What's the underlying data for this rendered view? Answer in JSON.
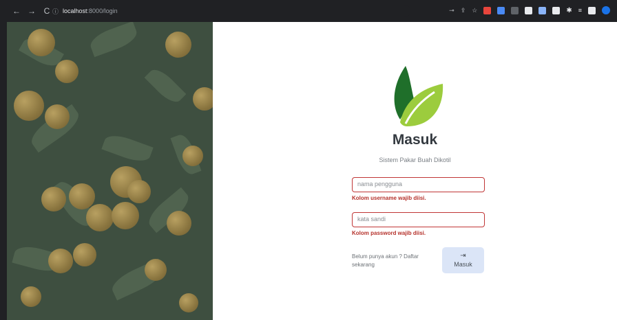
{
  "browser": {
    "host": "localhost",
    "path": ":8000/login"
  },
  "auth": {
    "title": "Masuk",
    "subtitle": "Sistem Pakar Buah Dikotil",
    "username_placeholder": "nama pengguna",
    "username_error": "Kolom username wajib diisi.",
    "password_placeholder": "kata sandi",
    "password_error": "Kolom password wajib diisi.",
    "signup_text": "Belum punya akun ? Daftar sekarang",
    "login_button_label": "Masuk"
  },
  "icons": {
    "logo": "leaf-logo-icon",
    "login": "login-arrow-icon"
  },
  "colors": {
    "error": "#b5312b",
    "button": "#dbe5f7",
    "leaf_dark": "#1f6f2a",
    "leaf_light": "#9ccc3d"
  }
}
